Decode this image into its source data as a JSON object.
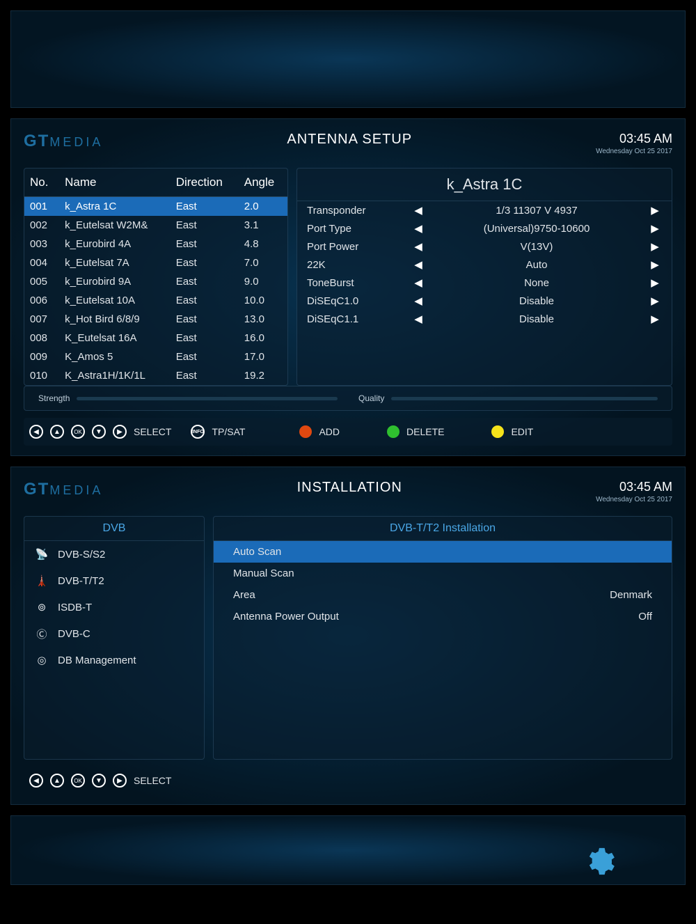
{
  "logo": {
    "gt": "GT",
    "media": "MEDIA"
  },
  "clock": {
    "time": "03:45 AM",
    "date": "Wednesday  Oct 25 2017"
  },
  "antenna": {
    "title": "ANTENNA SETUP",
    "cols": {
      "no": "No.",
      "name": "Name",
      "dir": "Direction",
      "angle": "Angle"
    },
    "rows": [
      {
        "no": "001",
        "name": "k_Astra 1C",
        "dir": "East",
        "angle": "2.0"
      },
      {
        "no": "002",
        "name": "k_Eutelsat W2M&",
        "dir": "East",
        "angle": "3.1"
      },
      {
        "no": "003",
        "name": "k_Eurobird 4A",
        "dir": "East",
        "angle": "4.8"
      },
      {
        "no": "004",
        "name": "k_Eutelsat 7A",
        "dir": "East",
        "angle": "7.0"
      },
      {
        "no": "005",
        "name": "k_Eurobird 9A",
        "dir": "East",
        "angle": "9.0"
      },
      {
        "no": "006",
        "name": "k_Eutelsat 10A",
        "dir": "East",
        "angle": "10.0"
      },
      {
        "no": "007",
        "name": "k_Hot Bird 6/8/9",
        "dir": "East",
        "angle": "13.0"
      },
      {
        "no": "008",
        "name": "K_Eutelsat 16A",
        "dir": "East",
        "angle": "16.0"
      },
      {
        "no": "009",
        "name": "K_Amos 5",
        "dir": "East",
        "angle": "17.0"
      },
      {
        "no": "010",
        "name": "K_Astra1H/1K/1L",
        "dir": "East",
        "angle": "19.2"
      }
    ],
    "detail": {
      "name": "k_Astra 1C",
      "opts": [
        {
          "label": "Transponder",
          "value": "1/3 11307 V 4937"
        },
        {
          "label": "Port Type",
          "value": "(Universal)9750-10600"
        },
        {
          "label": "Port Power",
          "value": "V(13V)"
        },
        {
          "label": "22K",
          "value": "Auto"
        },
        {
          "label": "ToneBurst",
          "value": "None"
        },
        {
          "label": "DiSEqC1.0",
          "value": "Disable"
        },
        {
          "label": "DiSEqC1.1",
          "value": "Disable"
        }
      ]
    },
    "meters": {
      "strength": "Strength",
      "quality": "Quality"
    },
    "footer": {
      "select": "SELECT",
      "tpsat": "TP/SAT",
      "add": "ADD",
      "delete": "DELETE",
      "edit": "EDIT"
    }
  },
  "install": {
    "title": "INSTALLATION",
    "left_head": "DVB",
    "right_head": "DVB-T/T2 Installation",
    "dvb": [
      {
        "label": "DVB-S/S2"
      },
      {
        "label": "DVB-T/T2"
      },
      {
        "label": "ISDB-T"
      },
      {
        "label": "DVB-C"
      },
      {
        "label": "DB Management"
      }
    ],
    "opts": [
      {
        "label": "Auto Scan",
        "value": ""
      },
      {
        "label": "Manual Scan",
        "value": ""
      },
      {
        "label": "Area",
        "value": "Denmark"
      },
      {
        "label": "Antenna Power Output",
        "value": "Off"
      }
    ],
    "footer": {
      "select": "SELECT"
    }
  },
  "info_label": "INFO"
}
